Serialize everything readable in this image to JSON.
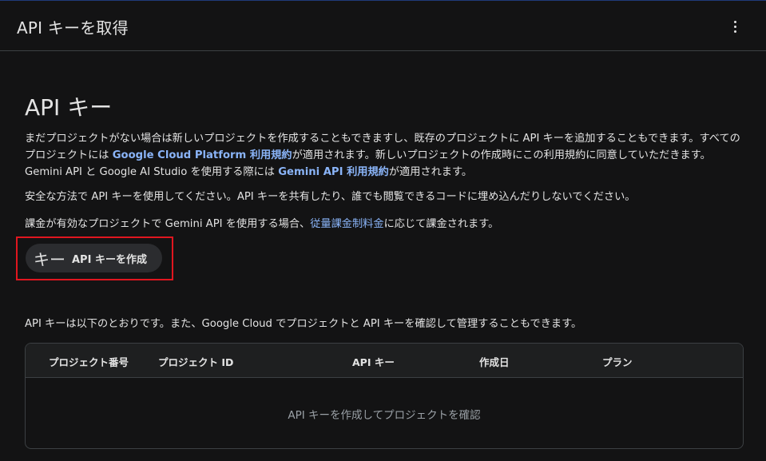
{
  "header": {
    "title": "API キーを取得"
  },
  "main": {
    "title": "API キー",
    "intro": {
      "part1": "まだプロジェクトがない場合は新しいプロジェクトを作成することもできますし、既存のプロジェクトに API キーを追加することもできます。すべてのプロジェクトには ",
      "link1": "Google Cloud Platform 利用規約",
      "part2": "が適用されます。新しいプロジェクトの作成時にこの利用規約に同意していただきます。Gemini API と Google AI Studio を使用する際には ",
      "link2": "Gemini API 利用規約",
      "part3": "が適用されます。"
    },
    "security_note": "安全な方法で API キーを使用してください。API キーを共有したり、誰でも閲覧できるコードに埋め込んだりしないでください。",
    "billing": {
      "part1": "課金が有効なプロジェクトで Gemini API を使用する場合、",
      "link": "従量課金制料金",
      "part2": "に応じて課金されます。"
    },
    "create_button": {
      "icon": "キー",
      "label": "API キーを作成"
    },
    "list_intro": "API キーは以下のとおりです。また、Google Cloud でプロジェクトと API キーを確認して管理することもできます。",
    "table": {
      "columns": [
        "プロジェクト番号",
        "プロジェクト ID",
        "API キー",
        "作成日",
        "プラン"
      ],
      "empty_text": "API キーを作成してプロジェクトを確認"
    }
  },
  "colors": {
    "background": "#131314",
    "link": "#8ab4f8",
    "highlight": "#e0161f"
  }
}
